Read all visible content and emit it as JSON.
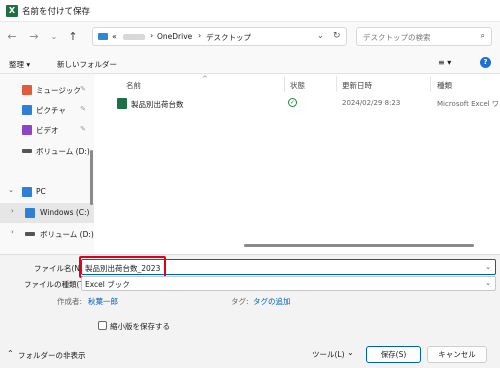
{
  "window": {
    "title": "名前を付けて保存",
    "app_icon": "excel-icon"
  },
  "nav": {
    "breadcrumb": [
      "«",
      "OneDrive",
      "デスクトップ"
    ],
    "breadcrumb_sep": "›",
    "search_placeholder": "デスクトップの検索"
  },
  "toolbar": {
    "organize_label": "整理 ▾",
    "new_folder_label": "新しいフォルダー",
    "view_label": "≡ ▾",
    "help_label": "?"
  },
  "sidebar": {
    "items": [
      {
        "label": "ミュージック",
        "icon": "music-icon",
        "color": "#e25b3a"
      },
      {
        "label": "ピクチャ",
        "icon": "pictures-icon",
        "color": "#2e7fd6"
      },
      {
        "label": "ビデオ",
        "icon": "video-icon",
        "color": "#8e44c8"
      },
      {
        "label": "ボリューム (D:)",
        "icon": "drive-icon",
        "color": "#555555"
      },
      {
        "label": "PC",
        "icon": "pc-icon",
        "color": "#2e7fd6"
      },
      {
        "label": "Windows (C:)",
        "icon": "windows-drive-icon",
        "color": "#2e7fd6"
      },
      {
        "label": "ボリューム (D:)",
        "icon": "drive-icon",
        "color": "#555555"
      }
    ]
  },
  "columns": {
    "name": "名前",
    "status": "状態",
    "modified": "更新日時",
    "type": "種類"
  },
  "files": [
    {
      "name": "製品別出荷台数",
      "status": "synced",
      "modified": "2024/02/29 8:23",
      "type": "Microsoft Excel ワ"
    }
  ],
  "form": {
    "filename_label": "ファイル名(N):",
    "filename_value": "製品別出荷台数_2023",
    "filetype_label": "ファイルの種類(T):",
    "filetype_value": "Excel ブック",
    "author_label": "作成者:",
    "author_value": "秋葉一郎",
    "tags_label": "タグ:",
    "tags_value": "タグの追加",
    "thumbnail_label": "縮小版を保存する"
  },
  "footer": {
    "hide_folders_label": "フォルダーの非表示",
    "tools_label": "ツール(L)",
    "save_label": "保存(S)",
    "cancel_label": "キャンセル"
  },
  "colors": {
    "accent": "#005fb8",
    "highlight_border": "#e0001b",
    "excel_green": "#1e7145"
  }
}
